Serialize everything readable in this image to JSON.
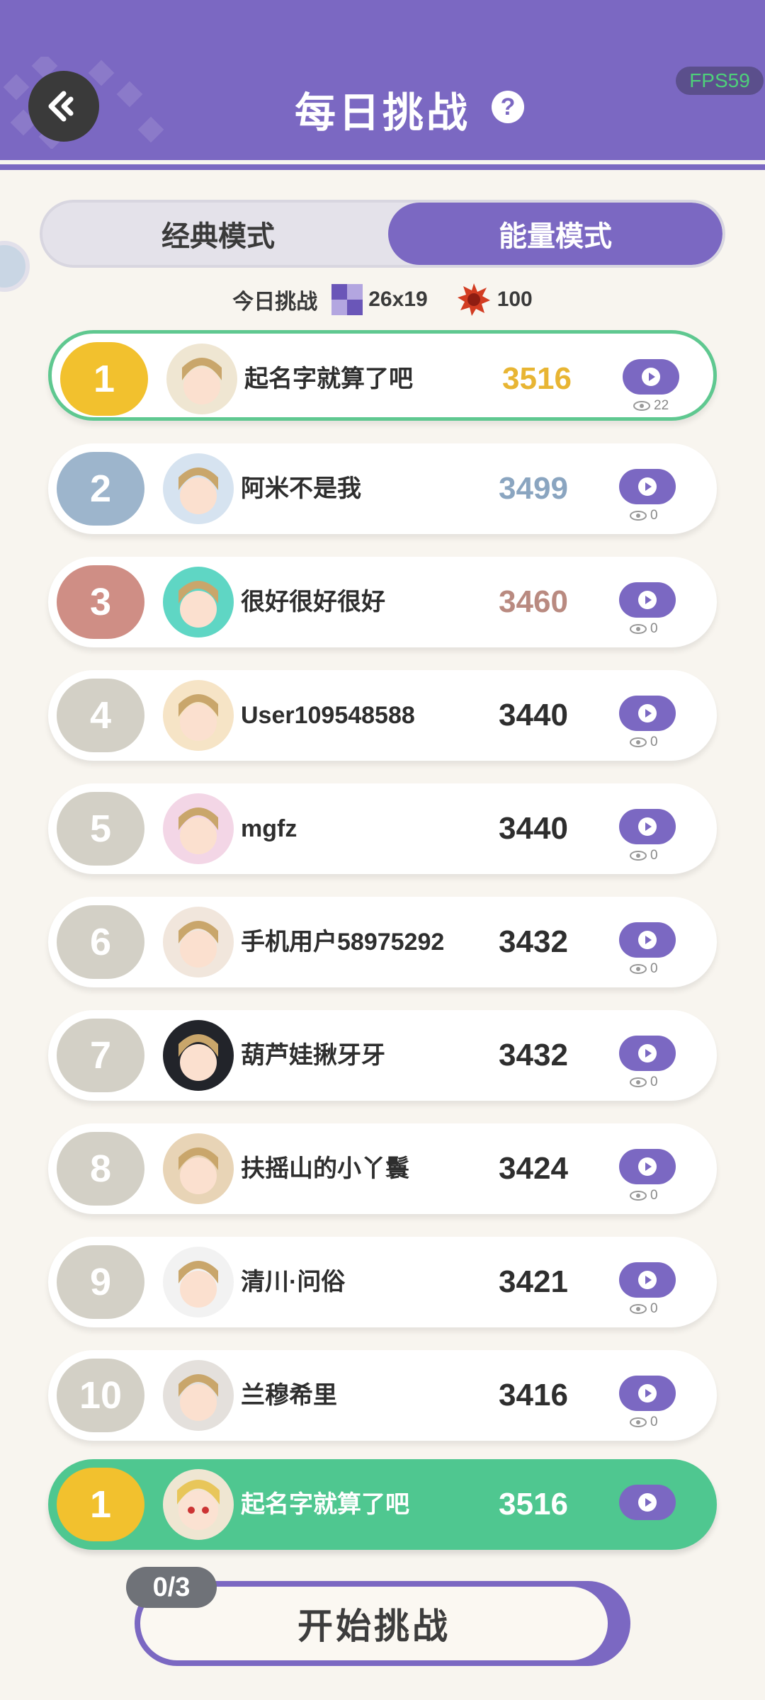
{
  "header": {
    "title": "每日挑战",
    "help_icon": "question-icon",
    "fps": "FPS59"
  },
  "mode_toggle": {
    "classic_label": "经典模式",
    "energy_label": "能量模式",
    "selected": "能量模式"
  },
  "challenge_info": {
    "label": "今日挑战",
    "grid_size": "26x19",
    "energy": "100"
  },
  "rankings": [
    {
      "rank": "1",
      "name": "起名字就算了吧",
      "score": "3516",
      "views": "22",
      "badge_color": "#f2c12e",
      "score_color": "#e8b533"
    },
    {
      "rank": "2",
      "name": "阿米不是我",
      "score": "3499",
      "views": "0",
      "badge_color": "#9db5cc",
      "score_color": "#8aa5c0"
    },
    {
      "rank": "3",
      "name": "很好很好很好",
      "score": "3460",
      "views": "0",
      "badge_color": "#cf8e85",
      "score_color": "#b98a80"
    },
    {
      "rank": "4",
      "name": "User109548588",
      "score": "3440",
      "views": "0",
      "badge_color": "#d3d0c6",
      "score_color": "#2e2e2e"
    },
    {
      "rank": "5",
      "name": "mgfz",
      "score": "3440",
      "views": "0",
      "badge_color": "#d3d0c6",
      "score_color": "#2e2e2e"
    },
    {
      "rank": "6",
      "name": "手机用户58975292",
      "score": "3432",
      "views": "0",
      "badge_color": "#d3d0c6",
      "score_color": "#2e2e2e"
    },
    {
      "rank": "7",
      "name": "葫芦娃揪牙牙",
      "score": "3432",
      "views": "0",
      "badge_color": "#d3d0c6",
      "score_color": "#2e2e2e"
    },
    {
      "rank": "8",
      "name": "扶摇山的小丫鬟",
      "score": "3424",
      "views": "0",
      "badge_color": "#d3d0c6",
      "score_color": "#2e2e2e"
    },
    {
      "rank": "9",
      "name": "清川·问俗",
      "score": "3421",
      "views": "0",
      "badge_color": "#d3d0c6",
      "score_color": "#2e2e2e"
    },
    {
      "rank": "10",
      "name": "兰穆希里",
      "score": "3416",
      "views": "0",
      "badge_color": "#d3d0c6",
      "score_color": "#2e2e2e"
    }
  ],
  "my_rank": {
    "rank": "1",
    "name": "起名字就算了吧",
    "score": "3516"
  },
  "start": {
    "attempts": "0/3",
    "label": "开始挑战"
  },
  "colors": {
    "primary": "#7b68c2",
    "highlight": "#4fc790",
    "background": "#f8f5ef"
  }
}
